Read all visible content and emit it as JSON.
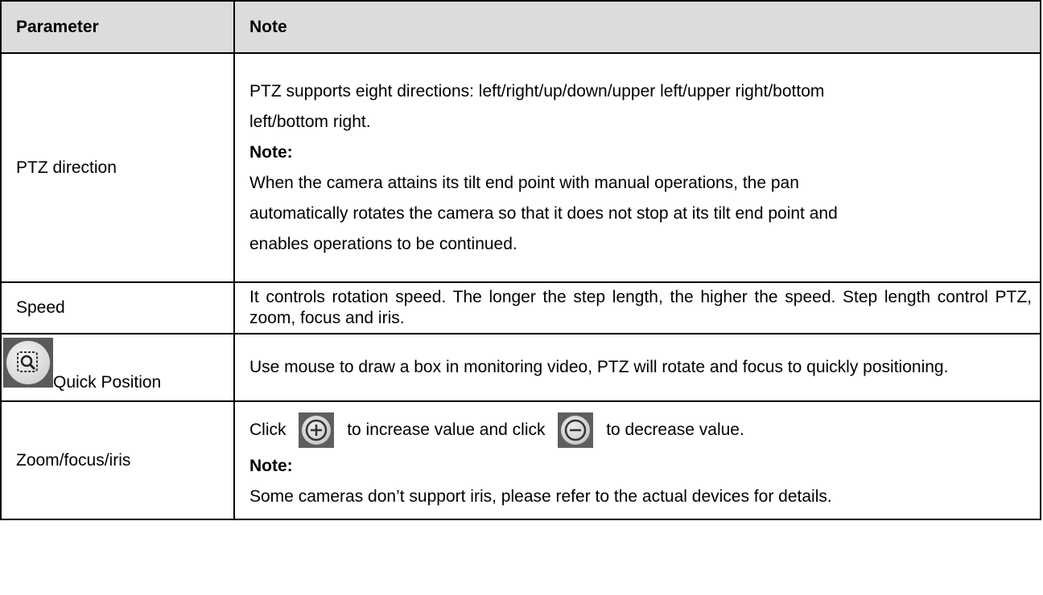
{
  "table": {
    "headers": {
      "parameter": "Parameter",
      "note": "Note"
    },
    "rows": {
      "ptz_direction": {
        "parameter": "PTZ direction",
        "line1": "PTZ supports eight directions: left/right/up/down/upper left/upper right/bottom",
        "line2": "left/bottom right.",
        "note_label": "Note:",
        "note_line1": "When the camera attains its tilt end point with manual operations, the pan",
        "note_line2": "automatically rotates the camera so that it does not stop at its tilt end point and",
        "note_line3": "enables operations to be continued."
      },
      "speed": {
        "parameter": "Speed",
        "text": "It controls rotation speed. The longer the step length, the higher the speed. Step length control PTZ, zoom, focus and iris."
      },
      "quick_position": {
        "parameter": "Quick Position",
        "icon": "quick-position-icon",
        "text": "Use mouse to draw a box in monitoring video, PTZ will rotate and focus to quickly positioning."
      },
      "zoom_focus_iris": {
        "parameter": "Zoom/focus/iris",
        "text_click": "Click",
        "plus_icon": "plus-icon",
        "text_increase": "to increase value and click",
        "minus_icon": "minus-icon",
        "text_decrease": "to decrease value.",
        "note_label": "Note:",
        "note_text": "Some cameras don’t support iris, please refer to the actual devices for details."
      }
    }
  }
}
